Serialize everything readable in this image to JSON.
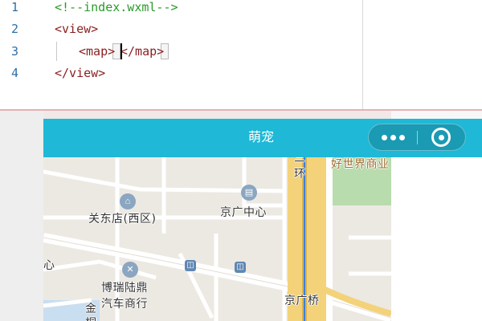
{
  "editor": {
    "lines": [
      {
        "number": "1",
        "text": "<!--index.wxml-->"
      },
      {
        "number": "2",
        "text": "<view>"
      },
      {
        "number": "3",
        "text_open": "<map>",
        "text_close": "</map>"
      },
      {
        "number": "4",
        "text": "</view>"
      }
    ]
  },
  "simulator": {
    "nav_title": "萌宠",
    "capsule": {
      "more_icon": "more-dots-icon",
      "close_icon": "target-circle-icon"
    },
    "map_labels": [
      "关东店(西区)",
      "京广中心",
      "好世界商业",
      "三",
      "环",
      "博瑞陆鼎",
      "汽车商行",
      "京广桥",
      "心",
      "金",
      "桐"
    ]
  },
  "colors": {
    "navbar": "#1fb8d6",
    "comment": "#2a9a2a",
    "tag": "#8a1f1f",
    "line_number": "#2f6fa5",
    "road_major": "#f3d27a"
  }
}
